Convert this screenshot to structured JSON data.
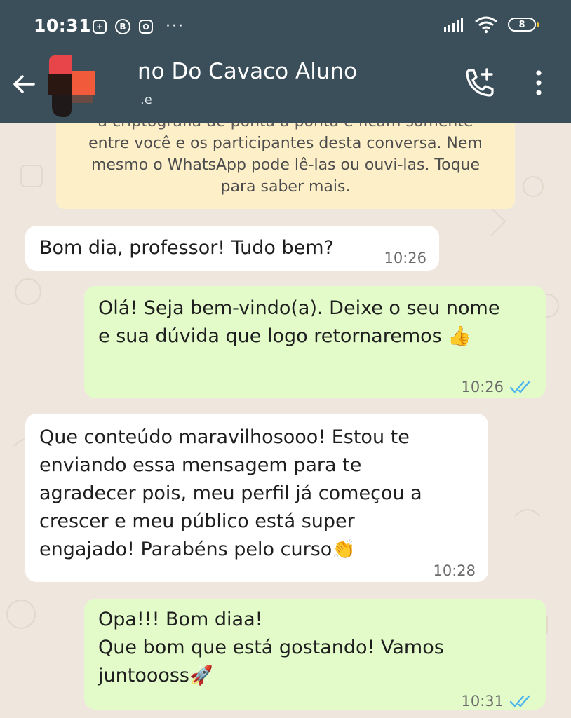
{
  "status_bar": {
    "time": "10:31",
    "battery": "8",
    "icons": [
      "plus-square-icon",
      "b-circle-icon",
      "instagram-icon",
      "more-dots-icon",
      "signal-icon",
      "wifi-icon",
      "battery-icon"
    ],
    "more": "···"
  },
  "header": {
    "title": "no Do Cavaco Aluno",
    "subtitle": ".e",
    "icons": [
      "back-arrow-icon",
      "add-call-icon",
      "overflow-menu-icon"
    ]
  },
  "encryption_notice": {
    "lines": [
      "a criptografia de ponta a ponta e ficam somente",
      "entre você e os participantes desta conversa. Nem",
      "mesmo o WhatsApp pode lê-las ou ouvi-las. Toque",
      "para saber mais."
    ]
  },
  "messages": [
    {
      "direction": "incoming",
      "lines": [
        "Bom dia, professor! Tudo bem?"
      ],
      "time": "10:26"
    },
    {
      "direction": "outgoing",
      "lines": [
        "Olá! Seja bem-vindo(a). Deixe o seu nome",
        "e sua dúvida que logo retornaremos"
      ],
      "emoji": "👍",
      "time": "10:26",
      "status": "read"
    },
    {
      "direction": "incoming",
      "lines": [
        "Que conteúdo maravilhosooo! Estou te",
        "enviando essa mensagem para te",
        "agradecer pois, meu perfil já começou a",
        "crescer e meu público está super",
        "engajado! Parabéns pelo curso"
      ],
      "emoji": "👏",
      "time": "10:28"
    },
    {
      "direction": "outgoing",
      "lines": [
        "Opa!!! Bom diaa!",
        "Que bom que está gostando! Vamos",
        "juntoooss"
      ],
      "emoji": "🚀",
      "time": "10:31",
      "status": "read"
    }
  ],
  "colors": {
    "header": "#3b4f5b",
    "chat_background": "#efe7de",
    "incoming_bubble": "#ffffff",
    "outgoing_bubble": "#e2fbc9",
    "notice": "#fdf0c9",
    "read_ticks": "#4fb6ec"
  }
}
